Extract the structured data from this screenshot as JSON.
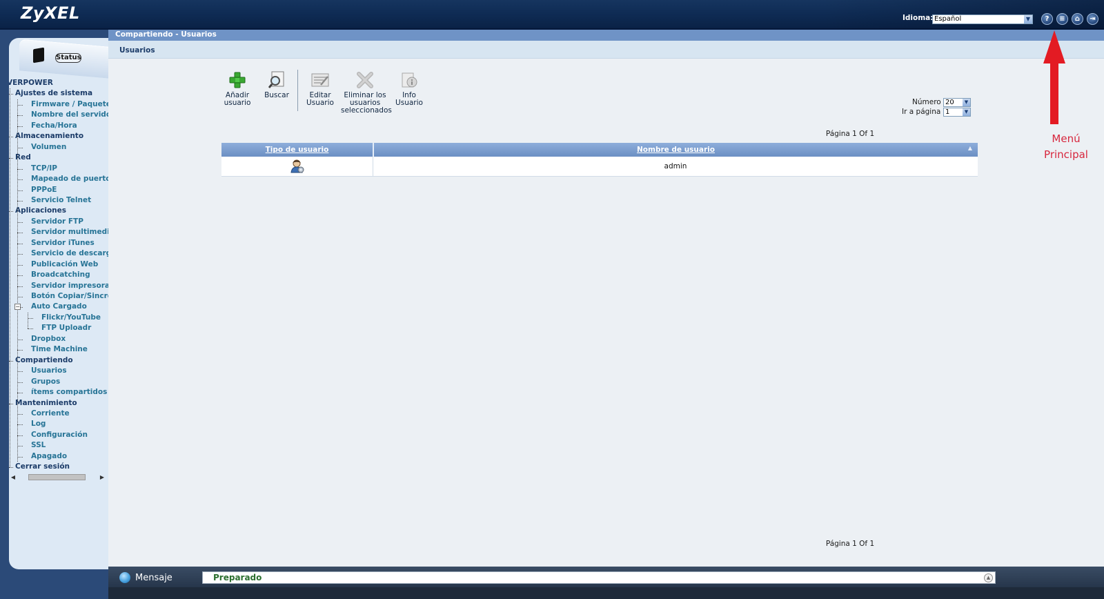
{
  "header": {
    "logo": "ZyXEL",
    "language_label": "Idioma:",
    "language_value": "Español",
    "buttons": [
      "help-icon",
      "document-icon",
      "home-icon",
      "logout-icon"
    ]
  },
  "sidebar": {
    "status_label": "Status",
    "nav": [
      {
        "label": "VERPOWER",
        "level": 0
      },
      {
        "label": "Ajustes de sistema",
        "level": 0
      },
      {
        "label": "Firmware / Paquetes",
        "level": 1
      },
      {
        "label": "Nombre del servidor",
        "level": 1
      },
      {
        "label": "Fecha/Hora",
        "level": 1
      },
      {
        "label": "Almacenamiento",
        "level": 0
      },
      {
        "label": "Volumen",
        "level": 1
      },
      {
        "label": "Red",
        "level": 0
      },
      {
        "label": "TCP/IP",
        "level": 1
      },
      {
        "label": "Mapeado de puertos U",
        "level": 1
      },
      {
        "label": "PPPoE",
        "level": 1
      },
      {
        "label": "Servicio Telnet",
        "level": 1
      },
      {
        "label": "Aplicaciones",
        "level": 0
      },
      {
        "label": "Servidor FTP",
        "level": 1
      },
      {
        "label": "Servidor multimedia",
        "level": 1
      },
      {
        "label": "Servidor iTunes",
        "level": 1
      },
      {
        "label": "Servicio de descargas",
        "level": 1
      },
      {
        "label": "Publicación Web",
        "level": 1
      },
      {
        "label": "Broadcatching",
        "level": 1
      },
      {
        "label": "Servidor impresora",
        "level": 1
      },
      {
        "label": "Botón Copiar/Sincron",
        "level": 1
      },
      {
        "label": "Auto Cargado",
        "level": 1
      },
      {
        "label": "Flickr/YouTube",
        "level": 2
      },
      {
        "label": "FTP Uploadr",
        "level": 2
      },
      {
        "label": "Dropbox",
        "level": 1
      },
      {
        "label": "Time Machine",
        "level": 1
      },
      {
        "label": "Compartiendo",
        "level": 0
      },
      {
        "label": "Usuarios",
        "level": 1
      },
      {
        "label": "Grupos",
        "level": 1
      },
      {
        "label": "ítems compartidos",
        "level": 1
      },
      {
        "label": "Mantenimiento",
        "level": 0
      },
      {
        "label": "Corriente",
        "level": 1
      },
      {
        "label": "Log",
        "level": 1
      },
      {
        "label": "Configuración",
        "level": 1
      },
      {
        "label": "SSL",
        "level": 1
      },
      {
        "label": "Apagado",
        "level": 1
      },
      {
        "label": "Cerrar sesión",
        "level": 0
      }
    ]
  },
  "main": {
    "breadcrumb": "Compartiendo - Usuarios",
    "section_title": "Usuarios",
    "toolbar": {
      "add_user": [
        "Añadir",
        "usuario"
      ],
      "search": [
        "Buscar"
      ],
      "edit_user": [
        "Editar",
        "Usuario"
      ],
      "delete_selected": [
        "Eliminar los",
        "usuarios",
        "seleccionados"
      ],
      "user_info": [
        "Info",
        "Usuario"
      ]
    },
    "pagination": {
      "number_label": "Número",
      "number_value": "20",
      "goto_label": "Ir a página",
      "goto_value": "1",
      "page_info": "Página 1 Of 1"
    },
    "table": {
      "columns": [
        "Tipo de usuario",
        "Nombre de usuario"
      ],
      "rows": [
        {
          "type_icon": "admin-user-icon",
          "name": "admin"
        }
      ]
    }
  },
  "message_bar": {
    "label": "Mensaje",
    "text": "Preparado"
  },
  "annotation": {
    "text_line1": "Menú",
    "text_line2": "Principal",
    "color": "#d7263d"
  },
  "colors": {
    "header_bg": "#0f2c55",
    "breadcrumb_bg": "#6f93c6",
    "table_header": "#7e9fd0",
    "nav_link": "#277496",
    "nav_category": "#1b3b68",
    "status_ready": "#2b6f2e"
  }
}
